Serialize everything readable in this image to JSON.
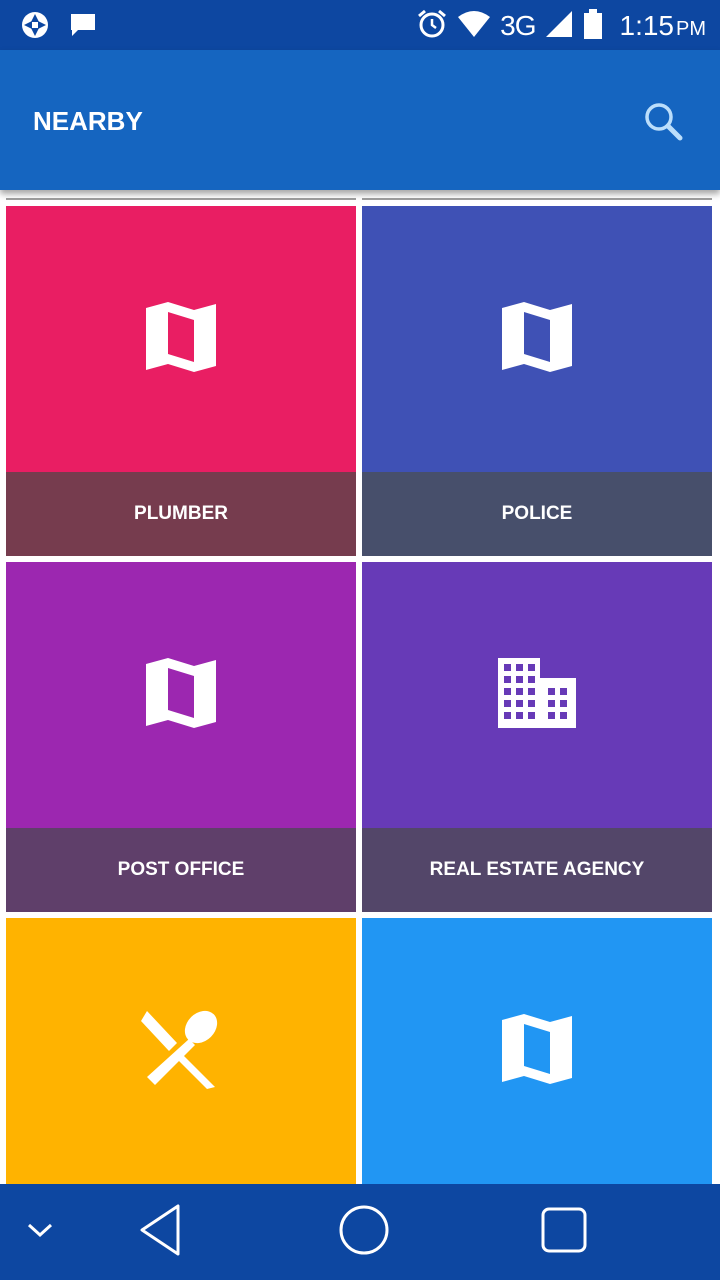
{
  "status_bar": {
    "time": "1:15",
    "ampm": "PM",
    "network": "3G",
    "icons": [
      "shutter-icon",
      "message-icon",
      "alarm-icon",
      "wifi-icon",
      "signal-icon",
      "battery-icon"
    ]
  },
  "app_bar": {
    "title": "NEARBY",
    "search_icon": "search-icon"
  },
  "tiles": [
    {
      "label": "PLUMBER",
      "icon": "map-icon",
      "color": "#e91e63",
      "caption_color": "#763c4e"
    },
    {
      "label": "POLICE",
      "icon": "map-icon",
      "color": "#3f51b5",
      "caption_color": "#474f6b"
    },
    {
      "label": "POST OFFICE",
      "icon": "map-icon",
      "color": "#9c27b0",
      "caption_color": "#5f3f6a"
    },
    {
      "label": "REAL ESTATE AGENCY",
      "icon": "building-icon",
      "color": "#673ab7",
      "caption_color": "#534669"
    },
    {
      "label": "",
      "icon": "restaurant-icon",
      "color": "#ffb300",
      "caption_color": ""
    },
    {
      "label": "",
      "icon": "map-icon",
      "color": "#2196f3",
      "caption_color": ""
    }
  ],
  "nav_bar": {
    "buttons": [
      "chevron-down-icon",
      "back-icon",
      "home-icon",
      "recents-icon"
    ]
  }
}
